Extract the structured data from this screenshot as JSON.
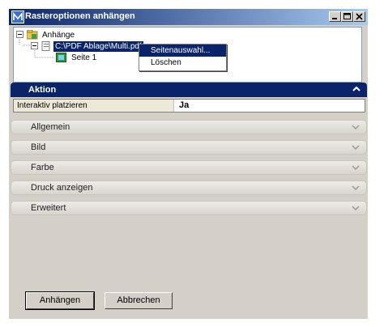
{
  "window": {
    "title": "Rasteroptionen anhängen"
  },
  "tree": {
    "root_label": "Anhänge",
    "file_label": "C:\\PDF Ablage\\Multi.pdf",
    "page_label": "Seite 1"
  },
  "context_menu": {
    "items": [
      "Seitenauswahl...",
      "Löschen"
    ]
  },
  "panel": {
    "aktion_label": "Aktion",
    "property": {
      "name": "Interaktiv platzieren",
      "value": "Ja"
    },
    "sections": [
      "Allgemein",
      "Bild",
      "Farbe",
      "Druck anzeigen",
      "Erweitert"
    ]
  },
  "buttons": {
    "attach_label": "Anhängen",
    "cancel_label": "Abbrechen"
  },
  "colors": {
    "title_bar": "#0a246a",
    "selection": "#0a246a",
    "window_bg": "#d4d0c8"
  }
}
